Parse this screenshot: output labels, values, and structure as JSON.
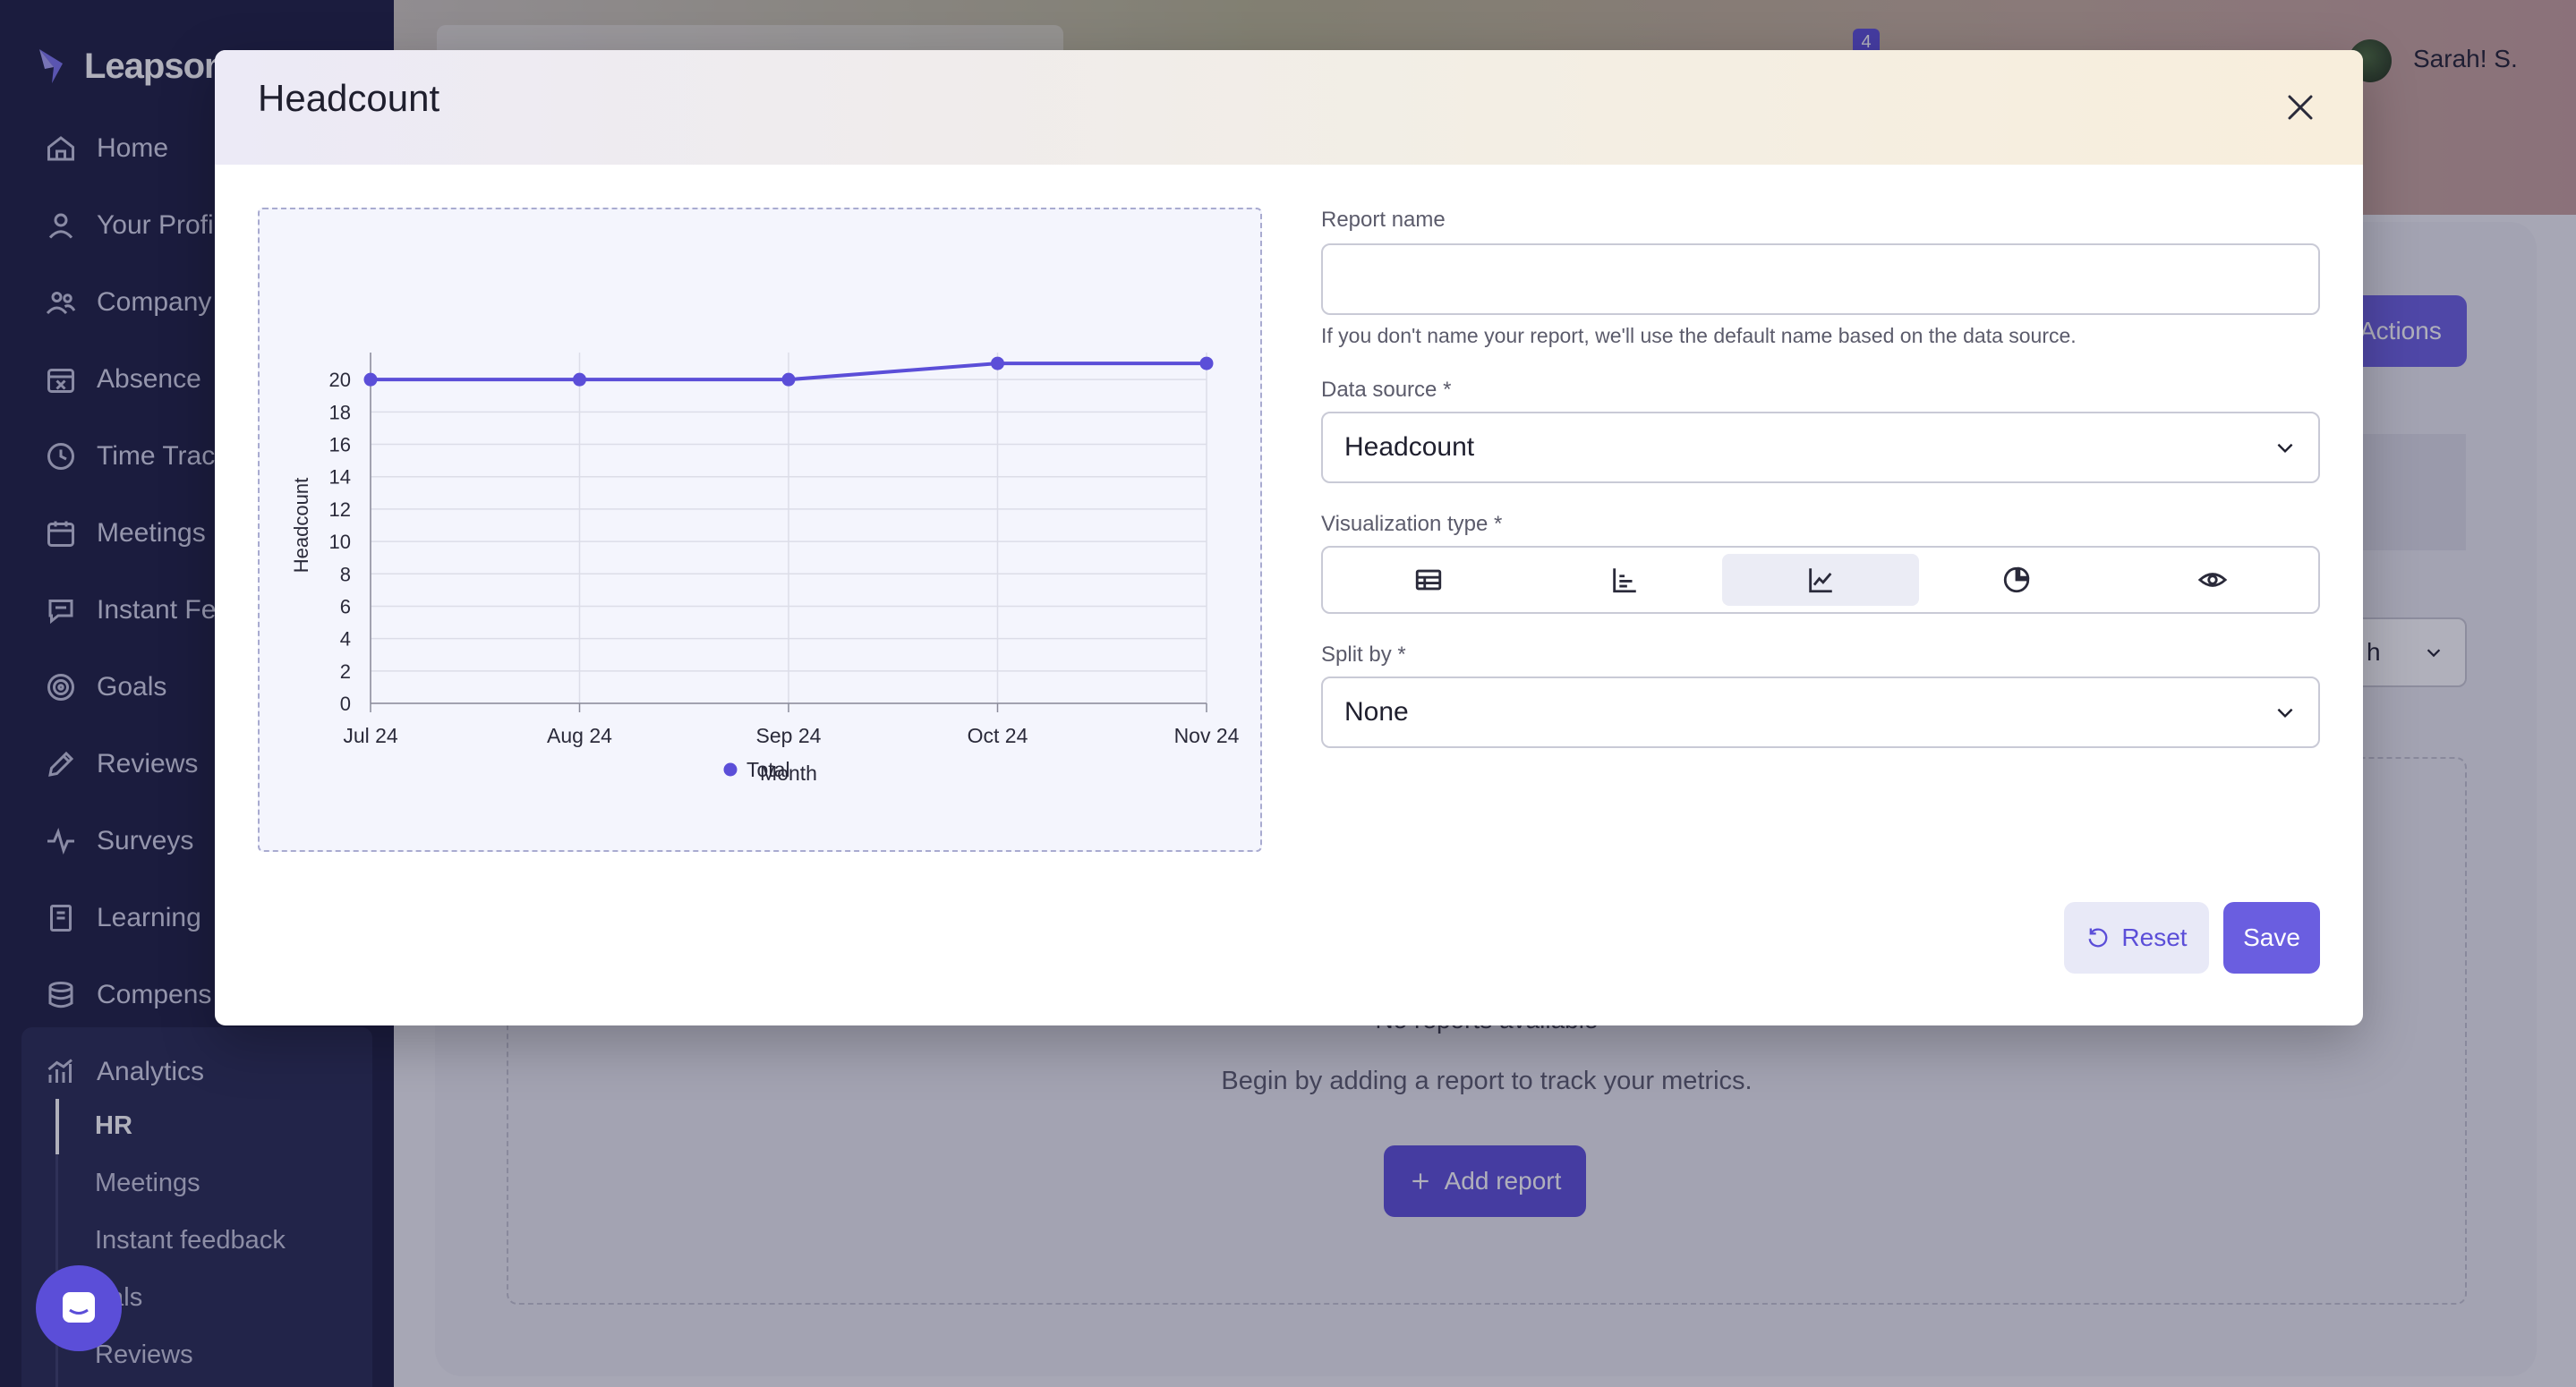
{
  "app": {
    "logo_text": "Leapsom"
  },
  "sidebar": {
    "items": [
      {
        "label": "Home",
        "icon": "home-icon"
      },
      {
        "label": "Your Profi",
        "icon": "user-icon"
      },
      {
        "label": "Company",
        "icon": "people-icon"
      },
      {
        "label": "Absence",
        "icon": "calendar-x-icon"
      },
      {
        "label": "Time Trac",
        "icon": "clock-icon"
      },
      {
        "label": "Meetings",
        "icon": "calendar-icon"
      },
      {
        "label": "Instant Fe",
        "icon": "chat-icon"
      },
      {
        "label": "Goals",
        "icon": "target-icon"
      },
      {
        "label": "Reviews",
        "icon": "pencil-icon"
      },
      {
        "label": "Surveys",
        "icon": "pulse-icon"
      },
      {
        "label": "Learning",
        "icon": "book-icon"
      },
      {
        "label": "Compens",
        "icon": "coins-icon"
      },
      {
        "label": "Analytics",
        "icon": "analytics-icon"
      }
    ],
    "sub_items": [
      {
        "label": "HR"
      },
      {
        "label": "Meetings"
      },
      {
        "label": "Instant feedback"
      },
      {
        "label": "pals"
      },
      {
        "label": "Reviews"
      }
    ]
  },
  "topbar": {
    "notification_count": "4",
    "user_name": "Sarah! S."
  },
  "background": {
    "actions_label": "Actions",
    "select_value": "h",
    "empty_title": "No reports available",
    "empty_subtitle": "Begin by adding a report to track your metrics.",
    "add_report_label": "Add report"
  },
  "modal": {
    "title": "Headcount",
    "report_name_label": "Report name",
    "report_name_value": "",
    "report_name_helper": "If you don't name your report, we'll use the default name based on the data source.",
    "data_source_label": "Data source *",
    "data_source_value": "Headcount",
    "viz_type_label": "Visualization type *",
    "viz_options": [
      {
        "icon": "table-icon"
      },
      {
        "icon": "bar-chart-icon"
      },
      {
        "icon": "line-chart-icon",
        "selected": true
      },
      {
        "icon": "pie-chart-icon"
      },
      {
        "icon": "eye-icon"
      }
    ],
    "split_by_label": "Split by *",
    "split_by_value": "None",
    "reset_label": "Reset",
    "save_label": "Save"
  },
  "colors": {
    "accent": "#5b4ed8",
    "sidebar_bg": "#1b1d3f",
    "line": "#5b4ed8"
  },
  "chart_data": {
    "type": "line",
    "categories": [
      "Jul 24",
      "Aug 24",
      "Sep 24",
      "Oct 24",
      "Nov 24"
    ],
    "series": [
      {
        "name": "Total",
        "values": [
          20,
          20,
          20,
          21,
          21
        ]
      }
    ],
    "xlabel": "Month",
    "ylabel": "Headcount",
    "ylim": [
      0,
      20
    ],
    "yticks": [
      0,
      2,
      4,
      6,
      8,
      10,
      12,
      14,
      16,
      18,
      20
    ],
    "grid": true,
    "legend": "bottom"
  }
}
